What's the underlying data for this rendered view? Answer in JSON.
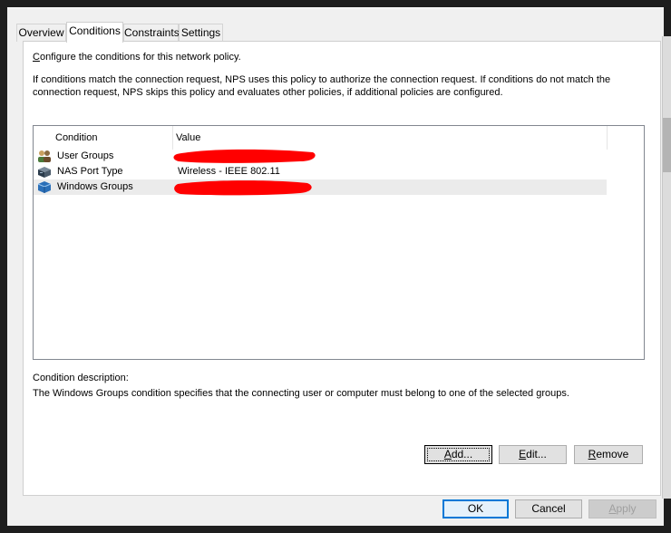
{
  "tabs": [
    {
      "label": "Overview"
    },
    {
      "label": "Conditions",
      "active": true
    },
    {
      "label": "Constraints"
    },
    {
      "label": "Settings"
    }
  ],
  "intro": {
    "line1_prefix": "C",
    "line1_rest": "onfigure the conditions for this network policy.",
    "para_line1": "If conditions match the connection request, NPS uses this policy to authorize the connection request. If conditions do not match the",
    "para_line2": "connection request, NPS skips this policy and evaluates other policies, if additional policies are configured."
  },
  "list": {
    "columns": [
      "Condition",
      "Value"
    ],
    "rows": [
      {
        "condition": "User Groups",
        "value": "",
        "icon": "user-groups-icon",
        "redacted": true
      },
      {
        "condition": "NAS Port Type",
        "value": "Wireless - IEEE 802.11",
        "icon": "nas-port-icon",
        "redacted": false
      },
      {
        "condition": "Windows Groups",
        "value": "",
        "icon": "windows-groups-icon",
        "redacted": true,
        "selected": true
      }
    ]
  },
  "description": {
    "label": "Condition description:",
    "text": "The Windows Groups condition specifies that the connecting user or computer must belong to one of the selected groups."
  },
  "actions": {
    "add": {
      "mnemonic": "A",
      "rest": "dd..."
    },
    "edit": {
      "mnemonic": "E",
      "rest": "dit..."
    },
    "remove": {
      "mnemonic": "R",
      "rest": "emove"
    }
  },
  "footer": {
    "ok": "OK",
    "cancel": "Cancel",
    "apply": {
      "mnemonic": "A",
      "rest": "pply"
    }
  },
  "colors": {
    "redaction": "#ff0000",
    "selection": "#ebebeb",
    "default_button_border": "#0078d7"
  }
}
